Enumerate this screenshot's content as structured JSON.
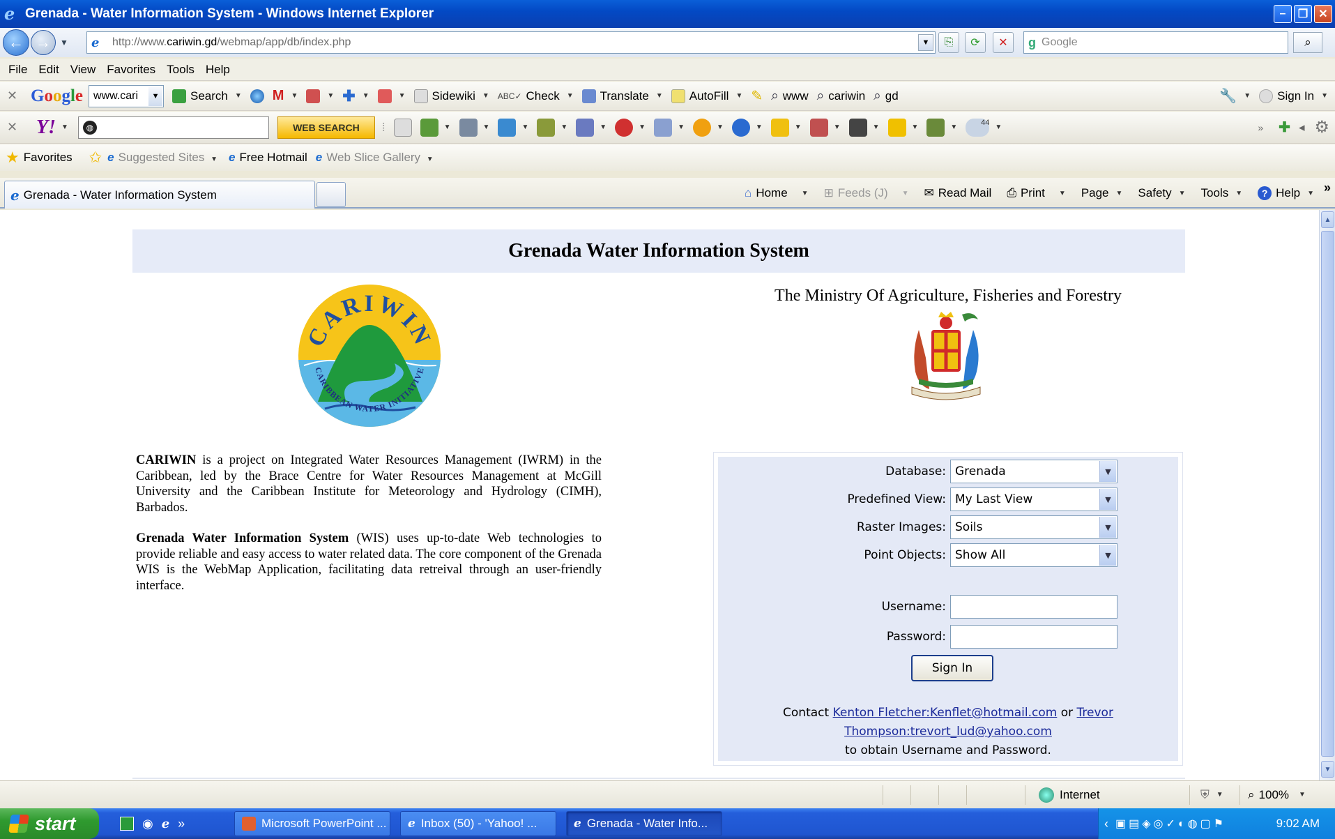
{
  "window": {
    "title": "Grenada - Water Information System - Windows Internet Explorer"
  },
  "address_bar": {
    "url_prefix": "http://www.",
    "url_domain": "cariwin.gd",
    "url_path": "/webmap/app/db/index.php",
    "search_placeholder": "Google"
  },
  "menu": [
    "File",
    "Edit",
    "View",
    "Favorites",
    "Tools",
    "Help"
  ],
  "google_toolbar": {
    "search_value": "www.cari",
    "search_label": "Search",
    "sidewiki_label": "Sidewiki",
    "check_label": "Check",
    "translate_label": "Translate",
    "autofill_label": "AutoFill",
    "www_label": "www",
    "cariwin_label": "cariwin",
    "gd_label": "gd",
    "signin_label": "Sign In"
  },
  "yahoo_toolbar": {
    "search_button": "WEB SEARCH",
    "weather_temp": "44"
  },
  "favorites_bar": {
    "favorites": "Favorites",
    "suggested": "Suggested Sites",
    "hotmail": "Free Hotmail",
    "webslice": "Web Slice Gallery"
  },
  "tab": {
    "title": "Grenada - Water Information System"
  },
  "command_bar": {
    "home": "Home",
    "feeds": "Feeds (J)",
    "readmail": "Read Mail",
    "print": "Print",
    "page": "Page",
    "safety": "Safety",
    "tools": "Tools",
    "help": "Help"
  },
  "page": {
    "heading": "Grenada Water Information System",
    "ministry": "The Ministry Of Agriculture, Fisheries and Forestry",
    "cariwin_logo_text": "CARIWIN",
    "cariwin_logo_sub": "CARIBBEAN WATER INITIATIVE",
    "about_p1_bold": "CARIWIN",
    "about_p1_rest": " is a project on Integrated Water Resources Management (IWRM) in the Caribbean, led by the Brace Centre for Water Resources Management at McGill University and the Caribbean Institute for Meteorology and Hydrology (CIMH), Barbados.",
    "about_p2_bold": "Grenada Water Information System",
    "about_p2_rest": " (WIS) uses up-to-date Web technologies to provide reliable and easy access to water related data. The core component of the Grenada WIS is the WebMap Application, facilitating data retreival through an user-friendly interface."
  },
  "login_form": {
    "database_label": "Database:",
    "database_value": "Grenada",
    "view_label": "Predefined View:",
    "view_value": "My Last View",
    "raster_label": "Raster Images:",
    "raster_value": "Soils",
    "point_label": "Point Objects:",
    "point_value": "Show All",
    "username_label": "Username:",
    "password_label": "Password:",
    "signin_button": "Sign In",
    "contact_prefix": "Contact ",
    "contact_link1": "Kenton Fletcher:Kenflet@hotmail.com",
    "contact_or": " or ",
    "contact_link2a": "Trevor",
    "contact_link2b": "Thompson:trevort_lud@yahoo.com",
    "contact_suffix": "to obtain Username and Password."
  },
  "status_bar": {
    "zone": "Internet",
    "zoom": "100%"
  },
  "taskbar": {
    "start": "start",
    "tasks": [
      "Microsoft PowerPoint ...",
      "Inbox (50) - 'Yahoo! ...",
      "Grenada - Water Info..."
    ],
    "clock": "9:02 AM"
  }
}
